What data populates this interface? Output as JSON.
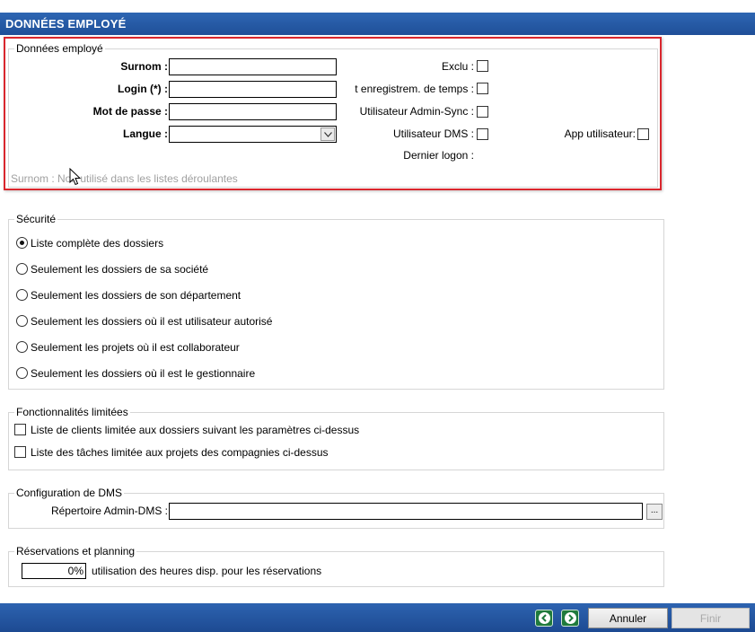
{
  "header": {
    "title": "DONNÉES EMPLOYÉ"
  },
  "employee": {
    "legend": "Données employé",
    "surnom_label": "Surnom :",
    "login_label": "Login (*) :",
    "password_label": "Mot de passe :",
    "langue_label": "Langue :",
    "surnom_value": "",
    "login_value": "",
    "password_value": "",
    "langue_value": "",
    "exclu_label": "Exclu :",
    "enregistrement_label": "t enregistrem. de temps :",
    "admin_sync_label": "Utilisateur Admin-Sync :",
    "dms_user_label": "Utilisateur DMS :",
    "app_user_label": "App utilisateur:",
    "dernier_logon_label": "Dernier logon :",
    "hint": "Surnom : Non utilisé dans les listes déroulantes"
  },
  "security": {
    "legend": "Sécurité",
    "options": [
      "Liste complète des dossiers",
      "Seulement les dossiers de sa société",
      "Seulement les dossiers de son département",
      "Seulement les dossiers où il est utilisateur autorisé",
      "Seulement les projets où il est collaborateur",
      "Seulement les dossiers où il est le gestionnaire"
    ],
    "selected_index": 0
  },
  "limited": {
    "legend": "Fonctionnalités limitées",
    "items": [
      "Liste de clients limitée aux dossiers suivant les paramètres ci-dessus",
      "Liste des tâches limitée aux projets des compagnies ci-dessus"
    ]
  },
  "dms": {
    "legend": "Configuration de DMS",
    "repertoire_label": "Répertoire Admin-DMS :",
    "repertoire_value": "",
    "browse_label": "..."
  },
  "reservations": {
    "legend": "Réservations et planning",
    "percent_value": "0%",
    "percent_label": "utilisation des heures disp. pour les réservations"
  },
  "footer": {
    "cancel_label": "Annuler",
    "finish_label": "Finir"
  },
  "colors": {
    "title_bar": "#2e66b3",
    "highlight_border": "#d9262d",
    "nav_button": "#1f7a3c"
  }
}
